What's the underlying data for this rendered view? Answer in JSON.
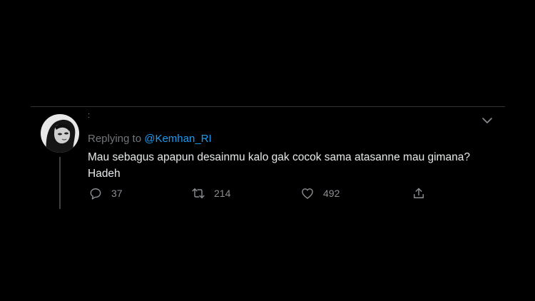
{
  "tweet": {
    "author_display": ":",
    "replying_prefix": "Replying to ",
    "replying_handle": "@Kemhan_RI",
    "text": "Mau sebagus apapun desainmu kalo gak cocok sama atasanne mau gimana? Hadeh",
    "avatar_icon": "user-avatar",
    "menu_icon": "chevron-down-icon"
  },
  "actions": {
    "reply": {
      "icon": "reply-icon",
      "count": "37"
    },
    "retweet": {
      "icon": "retweet-icon",
      "count": "214"
    },
    "like": {
      "icon": "heart-icon",
      "count": "492"
    },
    "share": {
      "icon": "share-icon"
    }
  },
  "colors": {
    "background": "#000000",
    "text": "#e7e9ea",
    "secondary": "#72767a",
    "accent": "#1d9bf0",
    "divider": "#2f3336"
  }
}
